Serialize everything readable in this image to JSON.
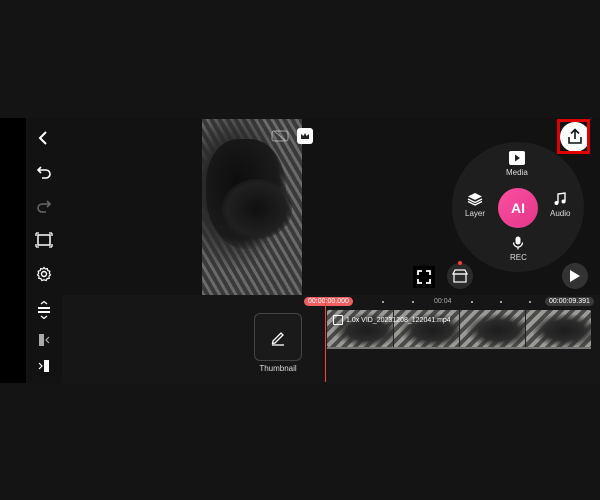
{
  "sidebar": {
    "items": [
      {
        "icon": "back-arrow-icon"
      },
      {
        "icon": "undo-icon"
      },
      {
        "icon": "redo-icon"
      },
      {
        "icon": "crop-icon"
      },
      {
        "icon": "settings-gear-icon"
      },
      {
        "icon": "track-height-icon"
      },
      {
        "icon": "collapse-left-icon"
      },
      {
        "icon": "expand-right-icon"
      }
    ]
  },
  "menu": {
    "media": "Media",
    "layer": "Layer",
    "audio": "Audio",
    "rec": "REC",
    "ai": "AI"
  },
  "timeline": {
    "time_start": "00:00:00.000",
    "time_mid": "00:04",
    "time_end": "00:00:09.391",
    "clip_label": "1.0x VID_20231208_122041.mp4"
  },
  "thumbnail": {
    "label": "Thumbnail"
  },
  "colors": {
    "accent_pink": "#e0368a",
    "highlight_red": "#e00000",
    "playhead_red": "#ff4040"
  }
}
